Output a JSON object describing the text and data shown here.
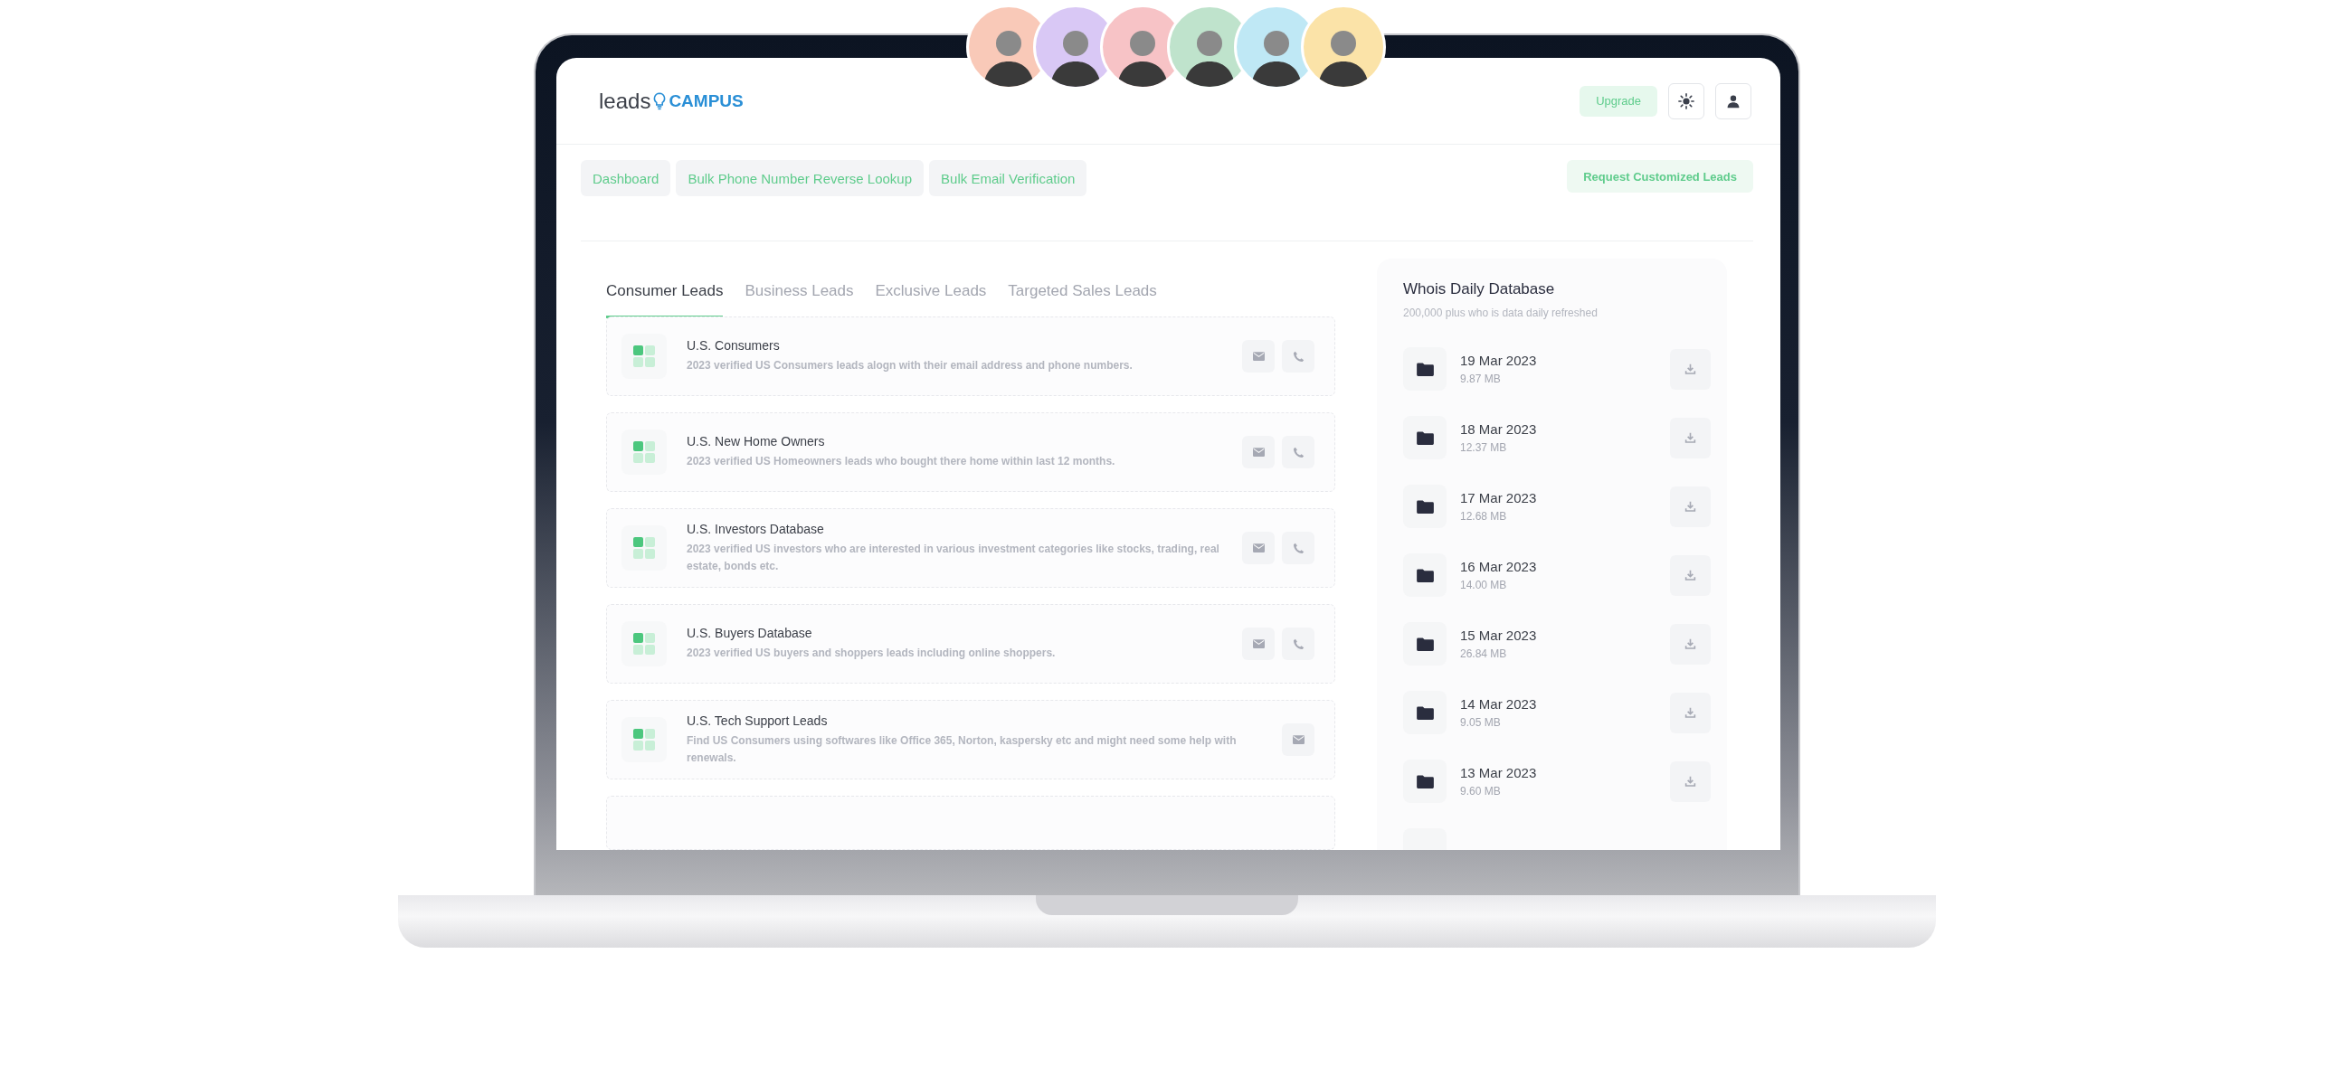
{
  "avatars": [
    {
      "color": "#f9c9b8"
    },
    {
      "color": "#d9c8f5"
    },
    {
      "color": "#f7c3c6"
    },
    {
      "color": "#bfe3cc"
    },
    {
      "color": "#bfe8f5"
    },
    {
      "color": "#fbe3a8"
    }
  ],
  "header": {
    "logo_text_1": "leads",
    "logo_text_2": "CAMPUS",
    "upgrade_button": "Upgrade"
  },
  "nav": [
    "Dashboard",
    "Bulk Phone Number Reverse Lookup",
    "Bulk Email Verification"
  ],
  "request_button": "Request Customized Leads",
  "tabs": [
    {
      "label": "Consumer Leads",
      "selected": true
    },
    {
      "label": "Business Leads",
      "selected": false
    },
    {
      "label": "Exclusive Leads",
      "selected": false
    },
    {
      "label": "Targeted Sales Leads",
      "selected": false
    }
  ],
  "leads": [
    {
      "title": "U.S. Consumers",
      "description": "2023 verified US Consumers leads alogn with their email address and phone numbers.",
      "actions": [
        {
          "kind": "email"
        },
        {
          "kind": "phone"
        }
      ]
    },
    {
      "title": "U.S. New Home Owners",
      "description": "2023 verified US Homeowners leads who bought there home within last 12 months.",
      "actions": [
        {
          "kind": "email"
        },
        {
          "kind": "phone"
        }
      ]
    },
    {
      "title": "U.S. Investors Database",
      "description": "2023 verified US investors who are interested in various investment categories like stocks, trading, real estate, bonds etc.",
      "actions": [
        {
          "kind": "email"
        },
        {
          "kind": "phone"
        }
      ]
    },
    {
      "title": "U.S. Buyers Database",
      "description": "2023 verified US buyers and shoppers leads including online shoppers.",
      "actions": [
        {
          "kind": "email"
        },
        {
          "kind": "phone"
        }
      ]
    },
    {
      "title": "U.S. Tech Support Leads",
      "description": "Find US Consumers using softwares like Office 365, Norton, kaspersky etc and might need some help with renewals.",
      "actions": [
        {
          "kind": "email"
        }
      ]
    }
  ],
  "whois": {
    "title": "Whois Daily Database",
    "subtitle": "200,000 plus who is data daily refreshed",
    "files": [
      {
        "date": "19 Mar 2023",
        "size": "9.87 MB"
      },
      {
        "date": "18 Mar 2023",
        "size": "12.37 MB"
      },
      {
        "date": "17 Mar 2023",
        "size": "12.68 MB"
      },
      {
        "date": "16 Mar 2023",
        "size": "14.00 MB"
      },
      {
        "date": "15 Mar 2023",
        "size": "26.84 MB"
      },
      {
        "date": "14 Mar 2023",
        "size": "9.05 MB"
      },
      {
        "date": "13 Mar 2023",
        "size": "9.60 MB"
      }
    ]
  }
}
